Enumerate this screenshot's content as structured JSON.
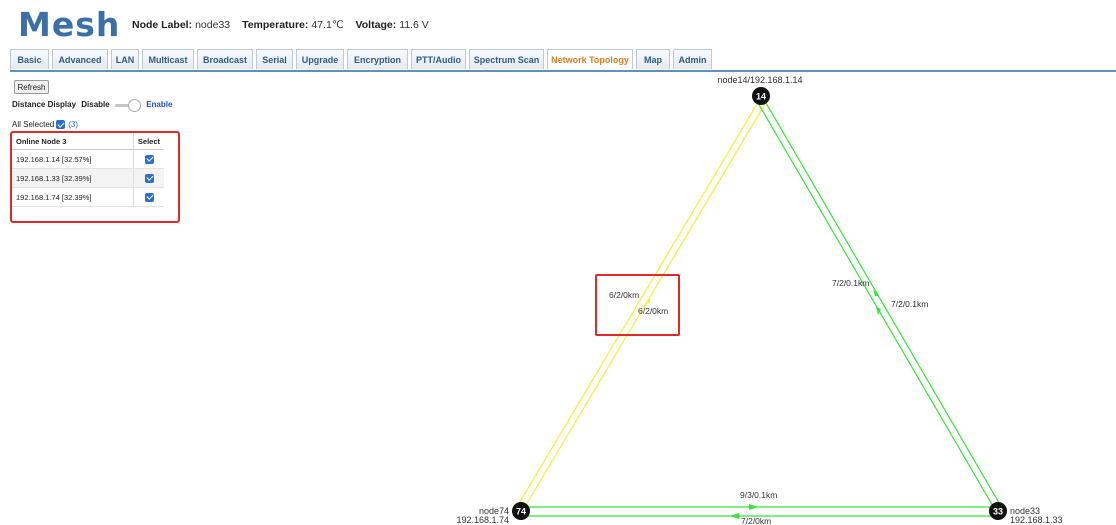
{
  "app": {
    "logo": "Mesh"
  },
  "status": {
    "node_label_key": "Node Label:",
    "node_label_value": "node33",
    "temperature_key": "Temperature:",
    "temperature_value": "47.1℃",
    "voltage_key": "Voltage:",
    "voltage_value": "11.6 V"
  },
  "tabs": [
    {
      "label": "Basic",
      "active": false
    },
    {
      "label": "Advanced",
      "active": false
    },
    {
      "label": "LAN",
      "active": false
    },
    {
      "label": "Multicast",
      "active": false
    },
    {
      "label": "Broadcast",
      "active": false
    },
    {
      "label": "Serial",
      "active": false
    },
    {
      "label": "Upgrade",
      "active": false
    },
    {
      "label": "Encryption",
      "active": false
    },
    {
      "label": "PTT/Audio",
      "active": false
    },
    {
      "label": "Spectrum Scan",
      "active": false
    },
    {
      "label": "Network Topology",
      "active": true
    },
    {
      "label": "Map",
      "active": false
    },
    {
      "label": "Admin",
      "active": false
    }
  ],
  "panel": {
    "refresh_label": "Refresh",
    "distance_display_label": "Distance Display",
    "disable_label": "Disable",
    "enable_label": "Enable",
    "all_selected_label": "All Selected",
    "all_selected_count": "(3)",
    "table": {
      "headers": [
        "Online Node 3",
        "Select"
      ],
      "rows": [
        {
          "node": "192.168.1.14 [32.57%]",
          "selected": true
        },
        {
          "node": "192.168.1.33 [32.39%]",
          "selected": true
        },
        {
          "node": "192.168.1.74 [32.39%]",
          "selected": true
        }
      ]
    }
  },
  "topology": {
    "nodes": {
      "n14": {
        "id": "14",
        "label": "node14/192.168.1.14"
      },
      "n74": {
        "id": "74",
        "name": "node74",
        "ip": "192.168.1.74"
      },
      "n33": {
        "id": "33",
        "name": "node33",
        "ip": "192.168.1.33"
      }
    },
    "links": {
      "l14_74_a": "6/2/0km",
      "l14_74_b": "6/2/0km",
      "l14_33_a": "7/2/0.1km",
      "l14_33_b": "7/2/0.1km",
      "l74_33_a": "9/3/0.1km",
      "l74_33_b": "7/2/0km"
    },
    "colors": {
      "strong_link": "#33e633",
      "weak_link": "#f2f233",
      "node_fill": "#111111",
      "highlight": "#e02a2a",
      "tab_active": "#e07b20",
      "logo": "#3b6fa8"
    }
  }
}
